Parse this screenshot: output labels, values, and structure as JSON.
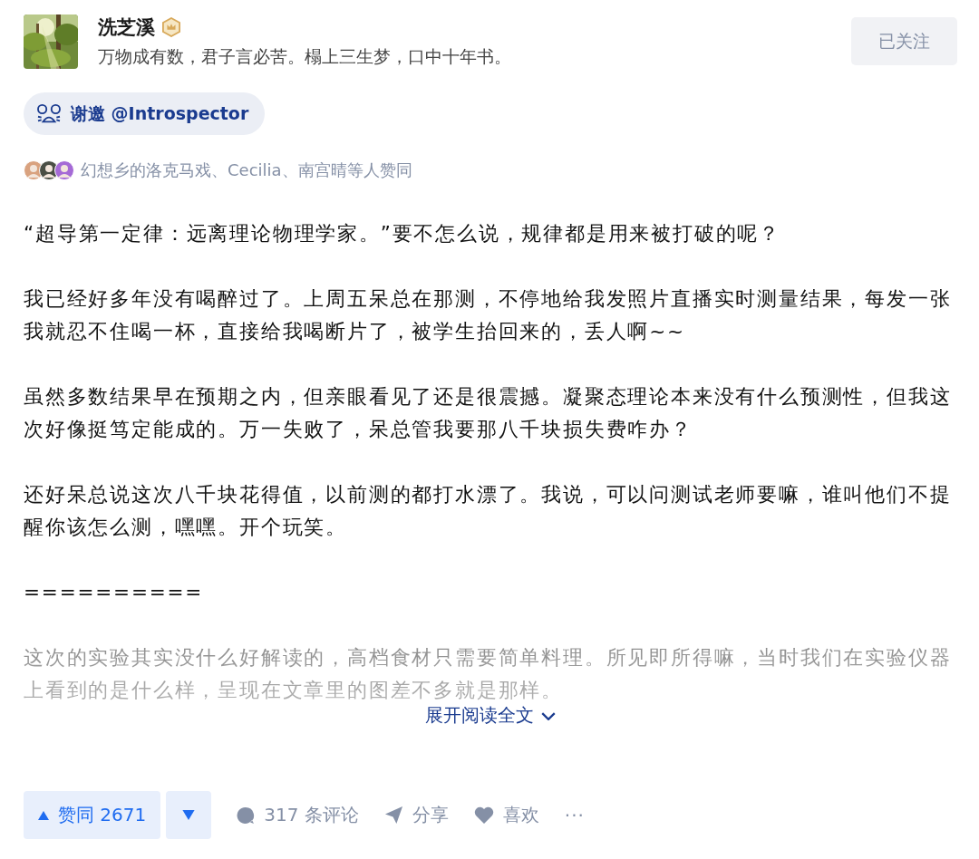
{
  "author": {
    "name": "洗芝溪",
    "bio": "万物成有数，君子言必苦。榻上三生梦，口中十年书。",
    "follow_button": "已关注"
  },
  "invite": {
    "text": "谢邀 @Introspector"
  },
  "voters": {
    "text": "幻想乡的洛克马戏、Cecilia、南宫晴等人赞同"
  },
  "content": {
    "truncated": true,
    "paragraphs": [
      "“超导第一定律：远离理论物理学家。”要不怎么说，规律都是用来被打破的呢？",
      "我已经好多年没有喝醉过了。上周五呆总在那测，不停地给我发照片直播实时测量结果，每发一张我就忍不住喝一杯，直接给我喝断片了，被学生抬回来的，丢人啊~~",
      "虽然多数结果早在预期之内，但亲眼看见了还是很震撼。凝聚态理论本来没有什么预测性，但我这次好像挺笃定能成的。万一失败了，呆总管我要那八千块损失费咋办？",
      "还好呆总说这次八千块花得值，以前测的都打水漂了。我说，可以问测试老师要嘛，谁叫他们不提醒你该怎么测，嘿嘿。开个玩笑。",
      "==========",
      "这次的实验其实没什么好解读的，高档食材只需要简单料理。所见即所得嘛，当时我们在实验仪器上看到的是什么样，呈现在文章里的图差不多就是那样。"
    ],
    "expand_link": "展开阅读全文"
  },
  "actions": {
    "upvote": "赞同 2671",
    "comments": "317 条评论",
    "share": "分享",
    "like": "喜欢",
    "more": "···"
  }
}
